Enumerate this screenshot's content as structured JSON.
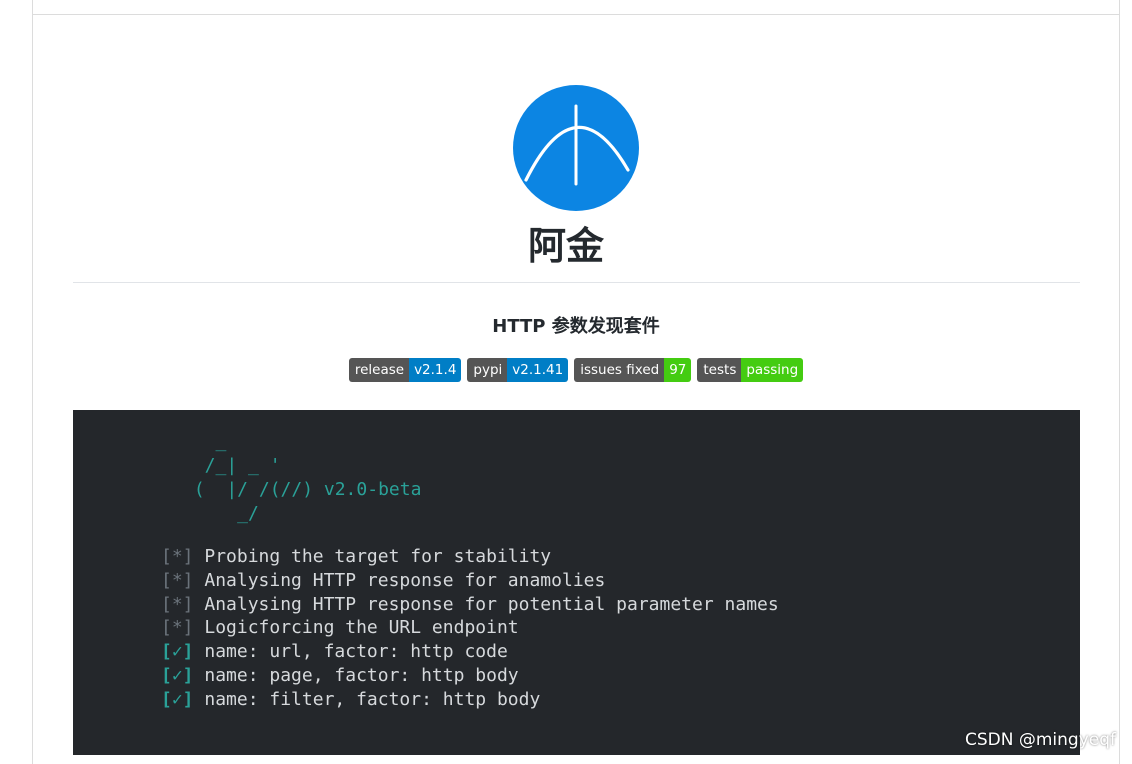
{
  "header": {
    "title": "阿金",
    "subtitle": "HTTP 参数发现套件"
  },
  "logo": {
    "icon": "compass-logo-icon",
    "color": "#0c85e3"
  },
  "badges": [
    {
      "label": "release",
      "value": "v2.1.4",
      "value_color": "#007ec6"
    },
    {
      "label": "pypi",
      "value": "v2.1.41",
      "value_color": "#007ec6"
    },
    {
      "label": "issues fixed",
      "value": "97",
      "value_color": "#4c1"
    },
    {
      "label": "tests",
      "value": "passing",
      "value_color": "#4c1"
    }
  ],
  "terminal": {
    "background": "#24272b",
    "ascii_art": "   _\n  /_| _ '\n (  |/ /(//) v2.0-beta\n     _/",
    "log_lines": [
      {
        "marker": "[*]",
        "type": "info",
        "text": "Probing the target for stability"
      },
      {
        "marker": "[*]",
        "type": "info",
        "text": "Analysing HTTP response for anamolies"
      },
      {
        "marker": "[*]",
        "type": "info",
        "text": "Analysing HTTP response for potential parameter names"
      },
      {
        "marker": "[*]",
        "type": "info",
        "text": "Logicforcing the URL endpoint"
      },
      {
        "marker": "[✓]",
        "type": "ok",
        "text": "name: url, factor: http code"
      },
      {
        "marker": "[✓]",
        "type": "ok",
        "text": "name: page, factor: http body"
      },
      {
        "marker": "[✓]",
        "type": "ok",
        "text": "name: filter, factor: http body"
      }
    ]
  },
  "watermark": "CSDN @mingyeqf"
}
